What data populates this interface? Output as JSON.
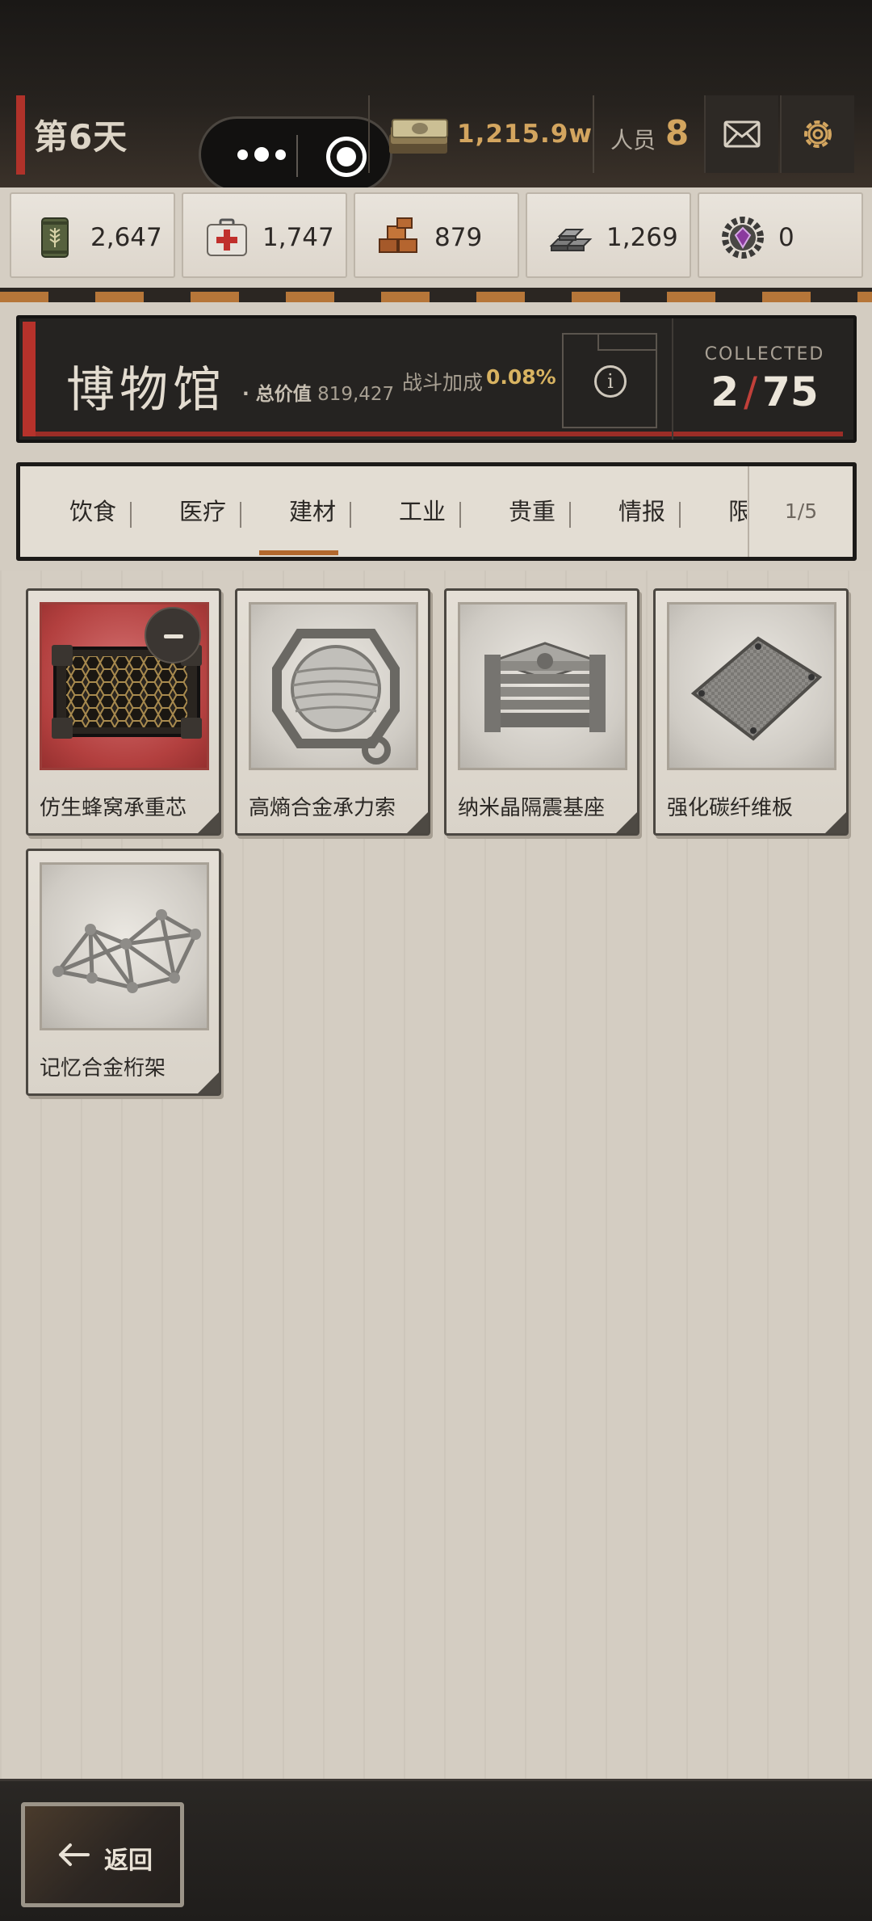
{
  "header": {
    "day": "第6天",
    "money": "1,215.9w",
    "staff_label": "人员",
    "staff_count": "8"
  },
  "resources": [
    {
      "icon": "grain-can-icon",
      "value": "2,647"
    },
    {
      "icon": "medkit-icon",
      "value": "1,747"
    },
    {
      "icon": "bricks-icon",
      "value": "879"
    },
    {
      "icon": "metal-ingots-icon",
      "value": "1,269"
    },
    {
      "icon": "gear-gem-icon",
      "value": "0"
    }
  ],
  "museum": {
    "title": "博物馆",
    "total_label": "· 总价值",
    "total_value": "819,427",
    "bonus_label": "战斗加成",
    "bonus_value": "0.08%",
    "collected_label": "COLLECTED",
    "collected_current": "2",
    "collected_total": "75"
  },
  "tabs": {
    "items": [
      "饮食",
      "医疗",
      "建材",
      "工业",
      "贵重",
      "情报",
      "限定"
    ],
    "active": "建材",
    "page_indicator": "1/5"
  },
  "items": [
    {
      "name": "仿生蜂窝承重芯",
      "highlighted": true,
      "icon": "honeycomb-core-icon"
    },
    {
      "name": "高熵合金承力索",
      "highlighted": false,
      "icon": "cable-reel-icon"
    },
    {
      "name": "纳米晶隔震基座",
      "highlighted": false,
      "icon": "seismic-base-icon"
    },
    {
      "name": "强化碳纤维板",
      "highlighted": false,
      "icon": "carbon-plate-icon"
    },
    {
      "name": "记忆合金桁架",
      "highlighted": false,
      "icon": "truss-icon"
    }
  ],
  "footer": {
    "back_label": "返回"
  },
  "colors": {
    "accent_gold": "#d3a55f",
    "accent_red": "#b6322b",
    "tab_underline": "#b3682d"
  }
}
